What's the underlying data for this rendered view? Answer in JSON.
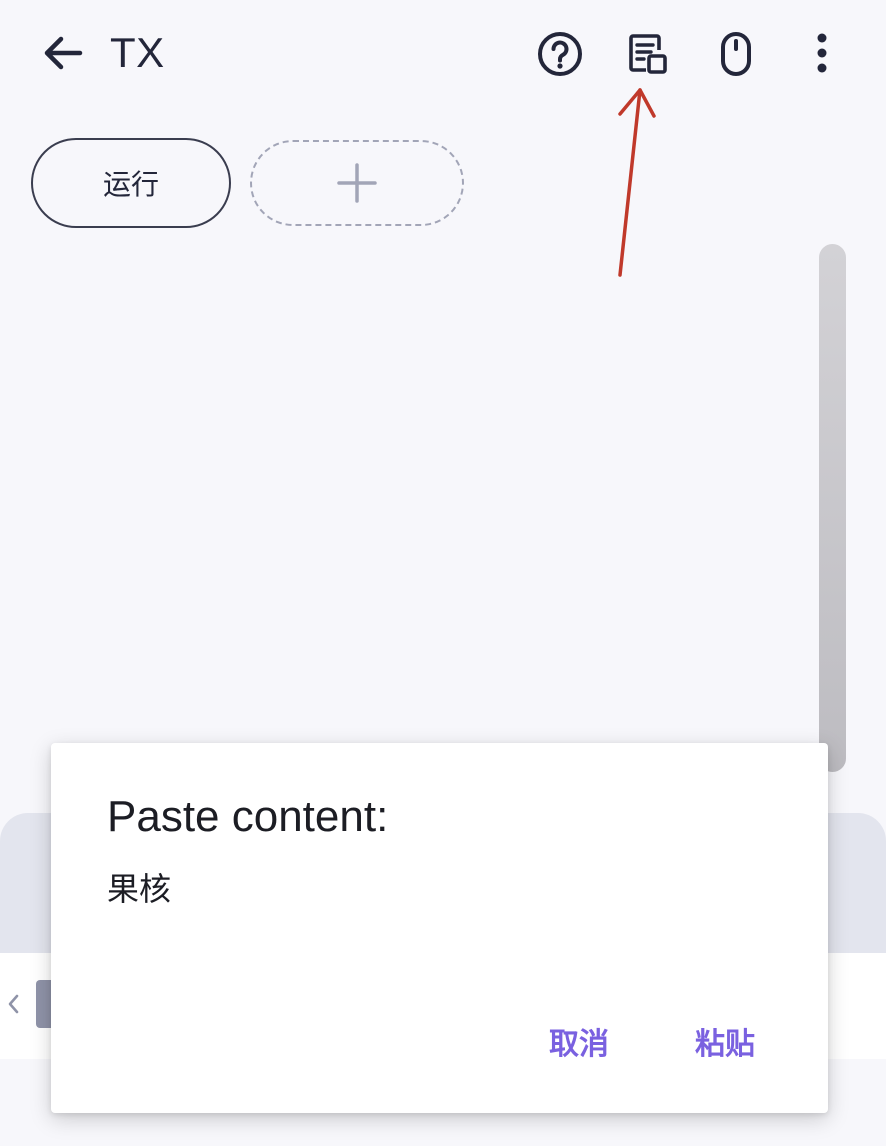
{
  "app_bar": {
    "title": "TX",
    "icons": {
      "back": "arrow-left-icon",
      "help": "help-circle-icon",
      "paste": "paste-clipboard-icon",
      "mouse": "mouse-icon",
      "more": "more-vertical-icon"
    }
  },
  "chips": {
    "run_label": "运行",
    "add_icon": "plus-icon"
  },
  "dialog": {
    "title": "Paste content:",
    "content": "果核",
    "cancel_label": "取消",
    "paste_label": "粘贴"
  },
  "colors": {
    "accent": "#7a61e0",
    "annotation": "#c0392b",
    "background": "#f7f7fb",
    "panel": "#e3e5ee"
  }
}
